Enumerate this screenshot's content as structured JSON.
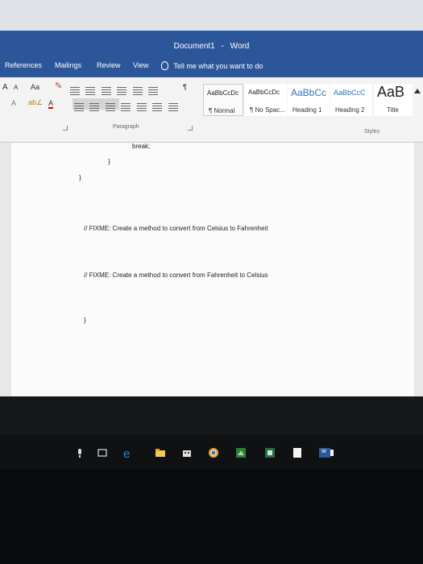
{
  "window": {
    "doc_title": "Document1",
    "separator": "-",
    "app_name": "Word"
  },
  "tabs": [
    "References",
    "Mailings",
    "Review",
    "View"
  ],
  "tell_me": "Tell me what you want to do",
  "ribbon": {
    "row1": [
      "A",
      "A",
      "Aa",
      "¶"
    ],
    "row2": [
      "A",
      "A"
    ],
    "paragraph_label": "Paragraph",
    "styles_label": "Styles"
  },
  "styles": [
    {
      "preview": "AaBbCcDc",
      "name": "¶ Normal",
      "active": true
    },
    {
      "preview": "AaBbCcDc",
      "name": "¶ No Spac..."
    },
    {
      "preview": "AaBbCc",
      "name": "Heading 1"
    },
    {
      "preview": "AaBbCcC",
      "name": "Heading 2"
    },
    {
      "preview": "AaB",
      "name": "Title"
    }
  ],
  "document": {
    "lines": [
      "break;",
      "}",
      "}",
      "// FIXME: Create a method to convert from Celsius to Fahrenheit",
      "// FIXME: Create a method to convert from Fahrenheit to Celsius",
      "}"
    ]
  },
  "taskbar": {
    "icons": [
      "microphone-icon",
      "task-view-icon",
      "edge-icon",
      "file-explorer-icon",
      "store-icon",
      "chrome-icon",
      "app-icon",
      "excel-icon",
      "notepad-icon",
      "word-icon"
    ],
    "word_label": "w"
  },
  "colors": {
    "word_blue": "#2b579a",
    "ribbon_bg": "#f3f3f3",
    "taskbar_bg": "#0f1113",
    "edge_blue": "#1e88e5"
  }
}
